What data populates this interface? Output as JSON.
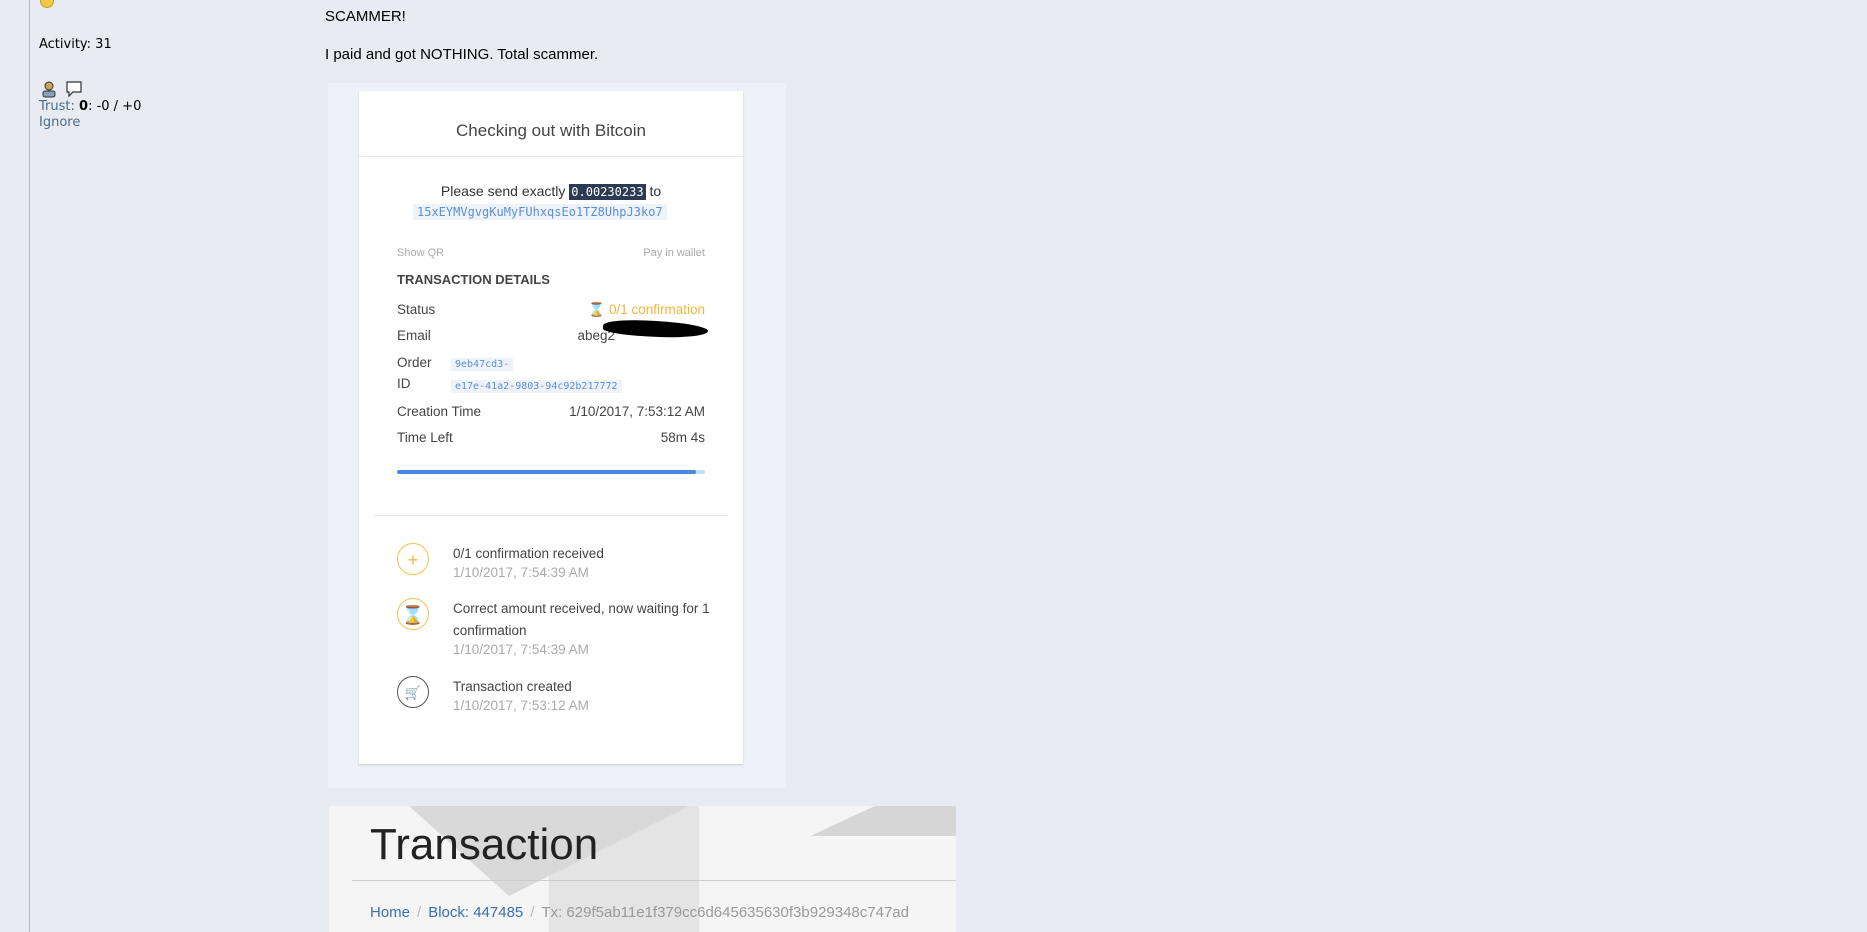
{
  "profile": {
    "activity": "Activity: 31",
    "trust_label": "Trust:",
    "trust_value": "0",
    "trust_rest": ": -0 / +0",
    "ignore": "Ignore"
  },
  "post": {
    "line1": "SCAMMER!",
    "line2": "I paid and got NOTHING.  Total scammer."
  },
  "checkout": {
    "title": "Checking out with Bitcoin",
    "send_prefix": "Please send exactly",
    "amount": "0.00230233",
    "send_suffix": "to",
    "address": "15xEYMVgvgKuMyFUhxqsEo1TZ8UhpJ3ko7",
    "show_qr": "Show QR",
    "pay_in_wallet": "Pay in wallet",
    "details_heading": "TRANSACTION DETAILS",
    "status_label": "Status",
    "status_value": "⌛ 0/1 confirmation",
    "email_label": "Email",
    "email_value": "abeg2",
    "order_label_1": "Order",
    "order_label_2": "ID",
    "order_id_1": "9eb47cd3-",
    "order_id_2": "e17e-41a2-9803-94c92b217772",
    "creation_label": "Creation Time",
    "creation_value": "1/10/2017, 7:53:12 AM",
    "time_left_label": "Time Left",
    "time_left_value": "58m 4s",
    "progress_fraction": 0.97,
    "events": [
      {
        "icon": "plus-icon",
        "text": "0/1 confirmation received",
        "time": "1/10/2017, 7:54:39 AM"
      },
      {
        "icon": "hourglass-icon",
        "text": "Correct amount received, now waiting for 1 confirmation",
        "time": "1/10/2017, 7:54:39 AM"
      },
      {
        "icon": "cart-icon",
        "text": "Transaction created",
        "time": "1/10/2017, 7:53:12 AM"
      }
    ]
  },
  "transaction": {
    "title": "Transaction",
    "crumb_home": "Home",
    "crumb_block": "Block: 447485",
    "crumb_tx": "Tx: 629f5ab11e1f379cc6d645635630f3b929348c747ad"
  }
}
